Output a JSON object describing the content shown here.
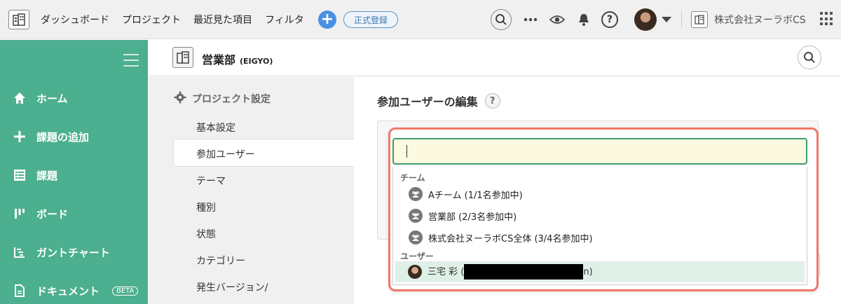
{
  "topbar": {
    "nav": [
      "ダッシュボード",
      "プロジェクト",
      "最近見た項目",
      "フィルタ"
    ],
    "add_label": "+",
    "register_label": "正式登録",
    "org_name": "株式会社ヌーラボCS",
    "help_icon_text": "?"
  },
  "sidebar": {
    "items": [
      {
        "label": "ホーム",
        "icon": "home-icon"
      },
      {
        "label": "課題の追加",
        "icon": "plus-icon"
      },
      {
        "label": "課題",
        "icon": "list-icon"
      },
      {
        "label": "ボード",
        "icon": "board-icon"
      },
      {
        "label": "ガントチャート",
        "icon": "gantt-icon"
      },
      {
        "label": "ドキュメント",
        "icon": "document-icon",
        "badge": "BETA"
      }
    ]
  },
  "project": {
    "name": "営業部",
    "key": "(EIGYO)"
  },
  "settings": {
    "title": "プロジェクト設定",
    "items": [
      "基本設定",
      "参加ユーザー",
      "テーマ",
      "種別",
      "状態",
      "カテゴリー",
      "発生バージョン/"
    ],
    "active_index": 1
  },
  "main": {
    "title": "参加ユーザーの編集",
    "help": "?"
  },
  "dropdown": {
    "input_value": "",
    "team_section": "チーム",
    "teams": [
      "Aチーム (1/1名参加中)",
      "営業部 (2/3名参加中)",
      "株式会社ヌーラボCS全体 (3/4名参加中)"
    ],
    "user_section": "ユーザー",
    "users": [
      {
        "name_prefix": "三宅 彩 (",
        "name_suffix": "n)"
      }
    ]
  },
  "colors": {
    "sidebar": "#4caf8f",
    "accent": "#4a90e2",
    "highlight_border": "#f07868",
    "input_border": "#3f9a6d",
    "input_bg": "#fbf9e0"
  }
}
